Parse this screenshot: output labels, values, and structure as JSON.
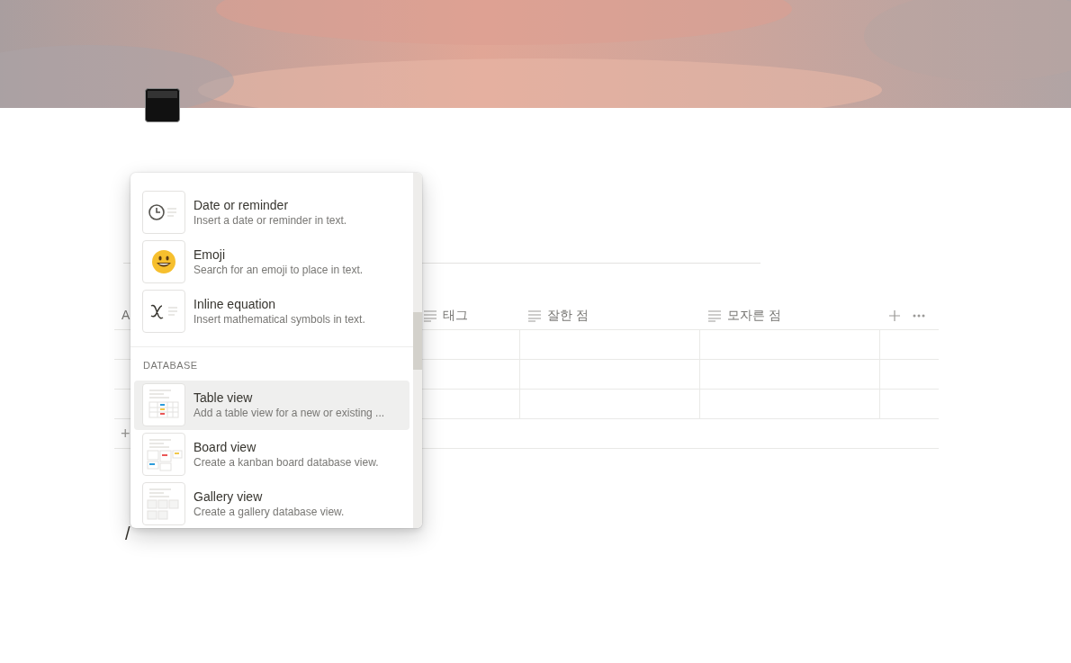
{
  "table": {
    "columns": [
      {
        "label": "A",
        "kind": "title"
      },
      {
        "label": "태그",
        "kind": "text"
      },
      {
        "label": "잘한 점",
        "kind": "text"
      },
      {
        "label": "모자른 점",
        "kind": "text"
      }
    ],
    "add_row": "+"
  },
  "editor_line": "/",
  "menu": {
    "sections": [
      {
        "items": [
          {
            "kind": "date",
            "title": "Date or reminder",
            "description": "Insert a date or reminder in text.",
            "selected": false
          },
          {
            "kind": "emoji",
            "title": "Emoji",
            "description": "Search for an emoji to place in text.",
            "selected": false
          },
          {
            "kind": "equation",
            "title": "Inline equation",
            "description": "Insert mathematical symbols in text.",
            "selected": false
          }
        ]
      },
      {
        "header": "DATABASE",
        "items": [
          {
            "kind": "table",
            "title": "Table view",
            "description": "Add a table view for a new or existing ...",
            "selected": true
          },
          {
            "kind": "board",
            "title": "Board view",
            "description": "Create a kanban board database view.",
            "selected": false
          },
          {
            "kind": "gallery",
            "title": "Gallery view",
            "description": "Create a gallery database view.",
            "selected": false
          }
        ]
      }
    ]
  }
}
